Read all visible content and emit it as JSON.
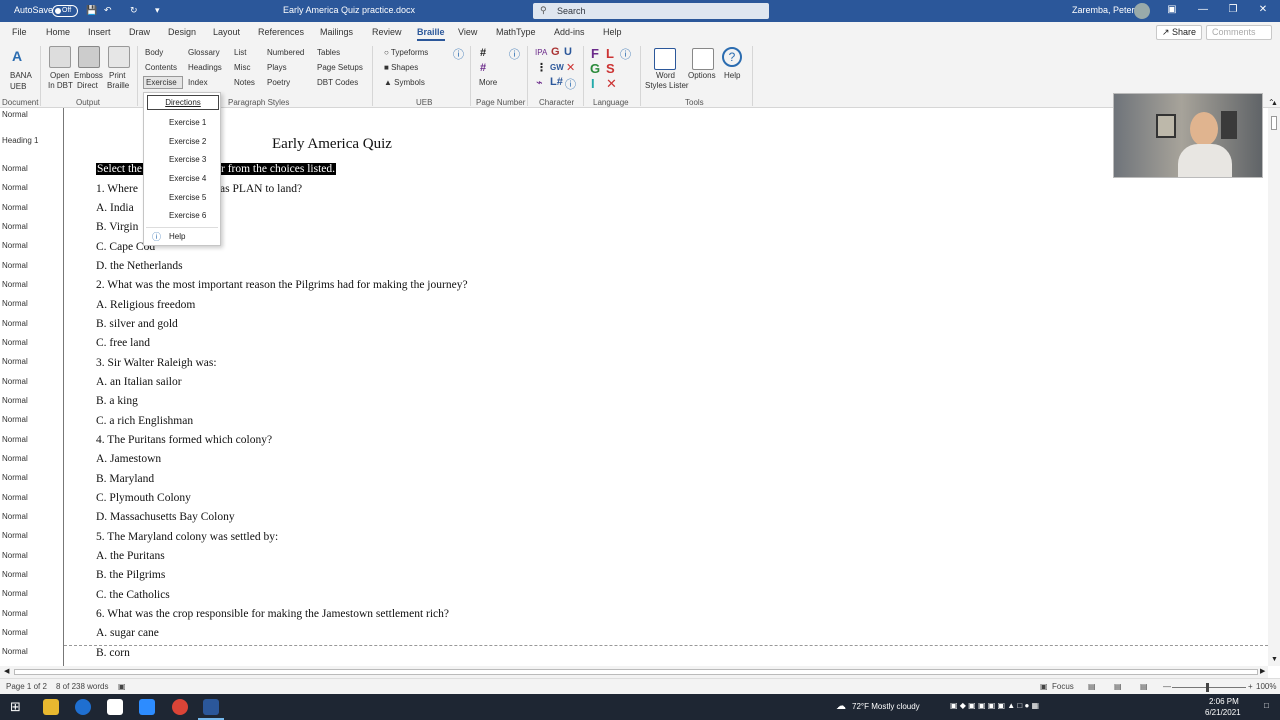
{
  "titlebar": {
    "autosave_label": "AutoSave",
    "autosave_state": "Off",
    "doc_title": "Early America Quiz practice.docx",
    "search_placeholder": "Search",
    "user_name": "Zaremba, Peter"
  },
  "tabs": [
    "File",
    "Home",
    "Insert",
    "Draw",
    "Design",
    "Layout",
    "References",
    "Mailings",
    "Review",
    "Braille",
    "View",
    "MathType",
    "Add-ins",
    "Help"
  ],
  "active_tab": "Braille",
  "share_label": "Share",
  "comments_label": "Comments",
  "ribbon": {
    "document": {
      "bana_label": "BANA",
      "ueb_label": "UEB",
      "group": "Document"
    },
    "output": {
      "open_label": "Open",
      "open_label2": "In DBT",
      "emboss_label": "Emboss",
      "emboss_label2": "Direct",
      "print_label": "Print",
      "print_label2": "Braille",
      "group": "Output"
    },
    "paragraph": {
      "col1": [
        "Body",
        "Contents",
        "Exercise"
      ],
      "col2": [
        "Glossary",
        "Headings",
        "Index"
      ],
      "col3": [
        "List",
        "Misc",
        "Notes"
      ],
      "col4": [
        "Numbered",
        "Plays",
        "Poetry"
      ],
      "col5": [
        "Tables",
        "Page Setups",
        "DBT Codes"
      ],
      "group": "Paragraph Styles"
    },
    "ueb": {
      "typeforms": "Typeforms",
      "shapes": "Shapes",
      "symbols": "Symbols",
      "group": "UEB"
    },
    "page_number": {
      "more": "More",
      "group": "Page Number"
    },
    "character": {
      "ipa": "IPA",
      "gw": "GW",
      "group": "Character"
    },
    "language": {
      "group": "Language"
    },
    "tools": {
      "word_label": "Word",
      "word_label2": "Styles Lister",
      "options": "Options",
      "help": "Help",
      "group": "Tools"
    }
  },
  "dropdown": {
    "items": [
      "Directions",
      "Exercise 1",
      "Exercise 2",
      "Exercise 3",
      "Exercise 4",
      "Exercise 5",
      "Exercise 6",
      "Help"
    ]
  },
  "style_labels": [
    "Normal",
    "Heading 1",
    "Normal",
    "Normal",
    "Normal",
    "Normal",
    "Normal",
    "Normal",
    "Normal",
    "Normal",
    "Normal",
    "Normal",
    "Normal",
    "Normal",
    "Normal",
    "Normal",
    "Normal",
    "Normal",
    "Normal",
    "Normal",
    "Normal",
    "Normal",
    "Normal",
    "Normal",
    "Normal",
    "Normal",
    "Normal",
    "Normal",
    "Normal"
  ],
  "document": {
    "title": "Early America Quiz",
    "directions_visible_left": "Select the",
    "directions_visible_right": "r from the choices listed.",
    "lines": [
      "1. Where",
      "as PLAN to land?",
      "A. India",
      "B. Virgin",
      "C. Cape Cod",
      "D. the Netherlands",
      "2. What was the most important reason the Pilgrims had for making the journey?",
      "A. Religious freedom",
      "B. silver and gold",
      "C. free land",
      "3. Sir Walter Raleigh was:",
      "A. an Italian sailor",
      "B. a king",
      "C. a rich Englishman",
      "4. The Puritans formed which colony?",
      "A. Jamestown",
      "B. Maryland",
      "C. Plymouth Colony",
      "D. Massachusetts Bay Colony",
      "5. The Maryland colony was settled by:",
      "A. the Puritans",
      "B. the Pilgrims",
      "C. the Catholics",
      "6. What was the crop responsible for making the Jamestown settlement rich?",
      "A. sugar cane",
      "B. corn"
    ]
  },
  "statusbar": {
    "page": "Page 1 of 2",
    "words": "8 of 238 words",
    "focus": "Focus",
    "zoom": "100%"
  },
  "taskbar": {
    "weather": "72°F  Mostly cloudy",
    "time": "2:06 PM",
    "date": "6/21/2021"
  }
}
